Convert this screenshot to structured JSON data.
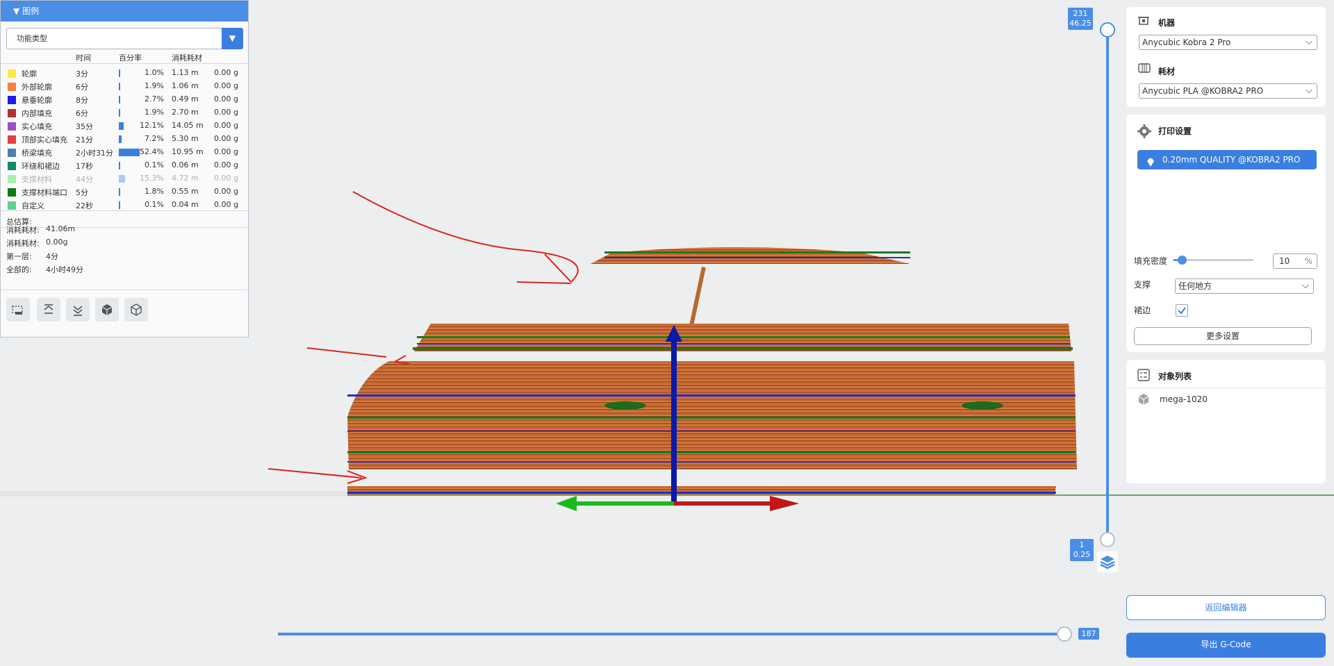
{
  "legend": {
    "title": "图例",
    "view_type": "功能类型",
    "columns": {
      "time": "时间",
      "percent": "百分率",
      "usage": "消耗耗材"
    },
    "rows": [
      {
        "label": "轮廓",
        "time": "3分",
        "pct": "1.0%",
        "len": "1.13 m",
        "wt": "0.00 g",
        "color": "#fee84a",
        "frac": 0.01,
        "dim": false
      },
      {
        "label": "外部轮廓",
        "time": "6分",
        "pct": "1.9%",
        "len": "1.06 m",
        "wt": "0.00 g",
        "color": "#fb7f3e",
        "frac": 0.019,
        "dim": false
      },
      {
        "label": "悬垂轮廓",
        "time": "8分",
        "pct": "2.7%",
        "len": "0.49 m",
        "wt": "0.00 g",
        "color": "#1d1de6",
        "frac": 0.027,
        "dim": false
      },
      {
        "label": "内部填充",
        "time": "6分",
        "pct": "1.9%",
        "len": "2.70 m",
        "wt": "0.00 g",
        "color": "#b33131",
        "frac": 0.019,
        "dim": false
      },
      {
        "label": "实心填充",
        "time": "35分",
        "pct": "12.1%",
        "len": "14.05 m",
        "wt": "0.00 g",
        "color": "#9852c2",
        "frac": 0.121,
        "dim": false
      },
      {
        "label": "顶部实心填充",
        "time": "21分",
        "pct": "7.2%",
        "len": "5.30 m",
        "wt": "0.00 g",
        "color": "#e24242",
        "frac": 0.072,
        "dim": false
      },
      {
        "label": "桥梁填充",
        "time": "2小时31分",
        "pct": "52.4%",
        "len": "10.95 m",
        "wt": "0.00 g",
        "color": "#4d80ac",
        "frac": 0.524,
        "dim": false
      },
      {
        "label": "环绕和裙边",
        "time": "17秒",
        "pct": "0.1%",
        "len": "0.06 m",
        "wt": "0.00 g",
        "color": "#0e8a6e",
        "frac": 0.001,
        "dim": false
      },
      {
        "label": "支撑材料",
        "time": "44分",
        "pct": "15.3%",
        "len": "4.72 m",
        "wt": "0.00 g",
        "color": "#a9f0a9",
        "frac": 0.153,
        "dim": true
      },
      {
        "label": "支撑材料端口",
        "time": "5分",
        "pct": "1.8%",
        "len": "0.55 m",
        "wt": "0.00 g",
        "color": "#0f7a0f",
        "frac": 0.018,
        "dim": false
      },
      {
        "label": "自定义",
        "time": "22秒",
        "pct": "0.1%",
        "len": "0.04 m",
        "wt": "0.00 g",
        "color": "#5fd38f",
        "frac": 0.001,
        "dim": false
      }
    ],
    "total_label": "总估算:",
    "totals": [
      {
        "k": "消耗耗材:",
        "v": "41.06m"
      },
      {
        "k": "消耗耗材:",
        "v": "0.00g"
      },
      {
        "k": "第一层:",
        "v": "4分"
      },
      {
        "k": "全部的:",
        "v": "4小时49分"
      }
    ]
  },
  "right": {
    "machine_title": "机器",
    "machine_value": "Anycubic Kobra 2 Pro",
    "filament_title": "耗材",
    "filament_value": "Anycubic PLA @KOBRA2 PRO",
    "print_title": "打印设置",
    "profile": "0.20mm QUALITY @KOBRA2 PRO",
    "infill_label": "填充密度",
    "infill_value": "10",
    "infill_unit": "%",
    "infill_frac": 0.1,
    "support_label": "支撑",
    "support_value": "任何地方",
    "brim_label": "裙边",
    "brim_checked": true,
    "more_settings": "更多设置",
    "objects_title": "对象列表",
    "object_name": "mega-1020",
    "back_button": "返回编辑器",
    "export_button": "导出 G-Code"
  },
  "slider": {
    "top_layer": "231",
    "top_height": "46.25",
    "bottom_layer": "1",
    "bottom_height": "0.25",
    "move_value": "187"
  }
}
